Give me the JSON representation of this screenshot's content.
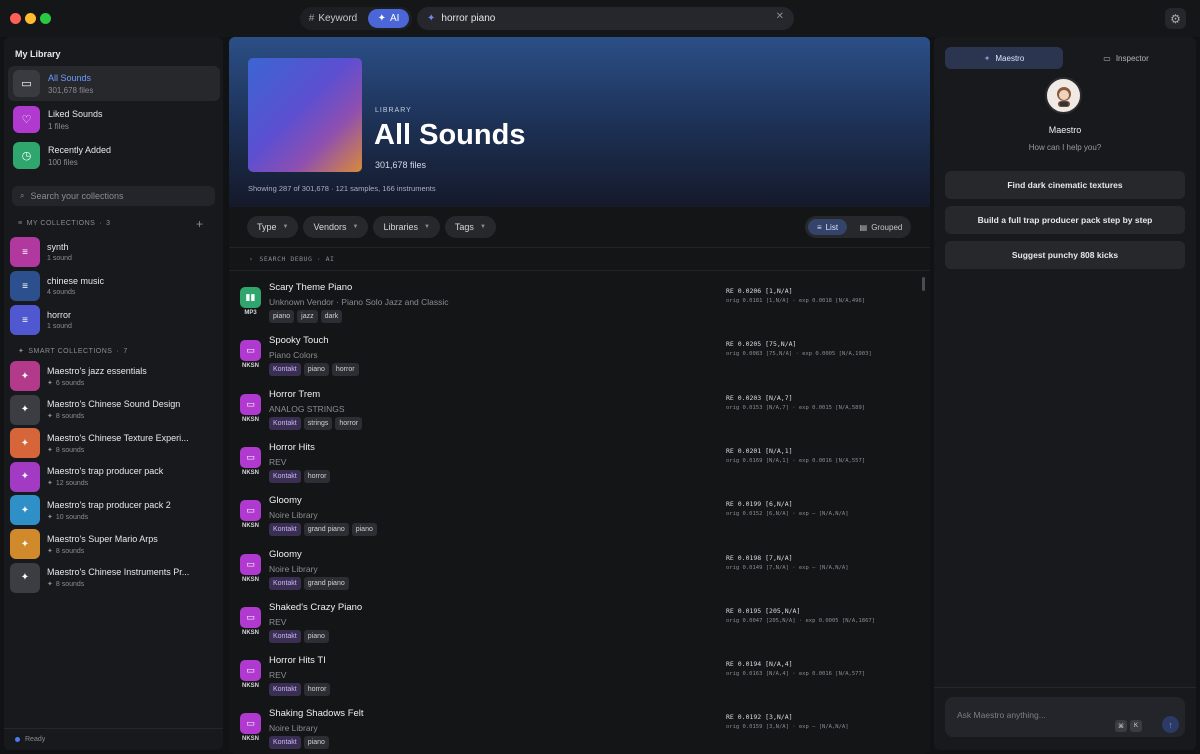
{
  "topbar": {
    "mode_keyword": "Keyword",
    "mode_ai": "AI",
    "search_value": "horror piano"
  },
  "sidebar": {
    "title": "My Library",
    "library": [
      {
        "name": "All Sounds",
        "count": "301,678 files",
        "icon": "folder-icon",
        "color": "#3a3b40",
        "active": true
      },
      {
        "name": "Liked Sounds",
        "count": "1 files",
        "icon": "heart-icon",
        "color": "#b03ad0",
        "active": false
      },
      {
        "name": "Recently Added",
        "count": "100 files",
        "icon": "clock-icon",
        "color": "#2fa66d",
        "active": false
      }
    ],
    "search_placeholder": "Search your collections",
    "my_collections_label": "MY COLLECTIONS",
    "my_collections_count": "3",
    "my_collections": [
      {
        "name": "synth",
        "count": "1 sound",
        "color": "#b0389f"
      },
      {
        "name": "chinese music",
        "count": "4 sounds",
        "color": "#2c4f8e"
      },
      {
        "name": "horror",
        "count": "1 sound",
        "color": "#4f58d0"
      }
    ],
    "smart_collections_label": "SMART COLLECTIONS",
    "smart_collections_count": "7",
    "smart_collections": [
      {
        "name": "Maestro's jazz essentials",
        "count": "6 sounds",
        "color": "#b33a8a"
      },
      {
        "name": "Maestro's Chinese Sound Design",
        "count": "8 sounds",
        "color": "#3c3d42"
      },
      {
        "name": "Maestro's Chinese Texture Experi...",
        "count": "8 sounds",
        "color": "#d6663a"
      },
      {
        "name": "Maestro's trap producer pack",
        "count": "12 sounds",
        "color": "#a23ac4"
      },
      {
        "name": "Maestro's trap producer pack 2",
        "count": "10 sounds",
        "color": "#2f8fc7"
      },
      {
        "name": "Maestro's Super Mario Arps",
        "count": "8 sounds",
        "color": "#d08a2c"
      },
      {
        "name": "Maestro's Chinese Instruments Pr...",
        "count": "8 sounds",
        "color": "#3c3d42"
      }
    ],
    "status": "Ready"
  },
  "main": {
    "hero_label": "LIBRARY",
    "hero_title": "All Sounds",
    "hero_files": "301,678 files",
    "hero_meta": "Showing 287 of 301,678 · 121 samples, 166 instruments",
    "filters": [
      "Type",
      "Vendors",
      "Libraries",
      "Tags"
    ],
    "view_list": "List",
    "view_grouped": "Grouped",
    "debug_label": "SEARCH DEBUG · AI",
    "rows": [
      {
        "name": "Scary Theme Piano",
        "vendor": "Unknown Vendor · Piano Solo Jazz and Classic",
        "format": "MP3",
        "icon_color": "#2fa66d",
        "tags": [
          "piano",
          "jazz",
          "dark"
        ],
        "kontakt": false,
        "score": "RE 0.0206 [1,N/A]",
        "orig": "orig 0.0181 [1,N/A] · exp 0.0018 [N/A,496]"
      },
      {
        "name": "Spooky Touch",
        "vendor": "Piano Colors",
        "format": "NKSN",
        "icon_color": "#b03ad0",
        "tags": [
          "Kontakt",
          "piano",
          "horror"
        ],
        "kontakt": true,
        "score": "RE 0.0205 [75,N/A]",
        "orig": "orig 0.0083 [75,N/A] · exp 0.0005 [N/A,1903]"
      },
      {
        "name": "Horror Trem",
        "vendor": "ANALOG STRINGS",
        "format": "NKSN",
        "icon_color": "#b03ad0",
        "tags": [
          "Kontakt",
          "strings",
          "horror"
        ],
        "kontakt": true,
        "score": "RE 0.0203 [N/A,7]",
        "orig": "orig 0.0153 [N/A,7] · exp 0.0015 [N/A,589]"
      },
      {
        "name": "Horror Hits",
        "vendor": "REV",
        "format": "NKSN",
        "icon_color": "#b03ad0",
        "tags": [
          "Kontakt",
          "horror"
        ],
        "kontakt": true,
        "score": "RE 0.0201 [N/A,1]",
        "orig": "orig 0.0169 [N/A,1] · exp 0.0016 [N/A,557]"
      },
      {
        "name": "Gloomy",
        "vendor": "Noire Library",
        "format": "NKSN",
        "icon_color": "#b03ad0",
        "tags": [
          "Kontakt",
          "grand piano",
          "piano"
        ],
        "kontakt": true,
        "score": "RE 0.0199 [6,N/A]",
        "orig": "orig 0.0152 [6,N/A] · exp – [N/A,N/A]"
      },
      {
        "name": "Gloomy",
        "vendor": "Noire Library",
        "format": "NKSN",
        "icon_color": "#b03ad0",
        "tags": [
          "Kontakt",
          "grand piano"
        ],
        "kontakt": true,
        "score": "RE 0.0198 [7,N/A]",
        "orig": "orig 0.0149 [7,N/A] · exp – [N/A,N/A]"
      },
      {
        "name": "Shaked's Crazy Piano",
        "vendor": "REV",
        "format": "NKSN",
        "icon_color": "#b03ad0",
        "tags": [
          "Kontakt",
          "piano"
        ],
        "kontakt": true,
        "score": "RE 0.0195 [205,N/A]",
        "orig": "orig 0.0047 [205,N/A] · exp 0.0005 [N/A,1867]"
      },
      {
        "name": "Horror Hits TI",
        "vendor": "REV",
        "format": "NKSN",
        "icon_color": "#b03ad0",
        "tags": [
          "Kontakt",
          "horror"
        ],
        "kontakt": true,
        "score": "RE 0.0194 [N/A,4]",
        "orig": "orig 0.0163 [N/A,4] · exp 0.0016 [N/A,577]"
      },
      {
        "name": "Shaking Shadows Felt",
        "vendor": "Noire Library",
        "format": "NKSN",
        "icon_color": "#b03ad0",
        "tags": [
          "Kontakt",
          "piano"
        ],
        "kontakt": true,
        "score": "RE 0.0192 [3,N/A]",
        "orig": "orig 0.0159 [3,N/A] · exp – [N/A,N/A]"
      }
    ]
  },
  "right": {
    "tab_maestro": "Maestro",
    "tab_inspector": "Inspector",
    "name": "Maestro",
    "help": "How can I help you?",
    "suggestions": [
      "Find dark cinematic textures",
      "Build a full trap producer pack step by step",
      "Suggest punchy 808 kicks"
    ],
    "ask_placeholder": "Ask Maestro anything...",
    "kbd1": "⌘",
    "kbd2": "K"
  }
}
